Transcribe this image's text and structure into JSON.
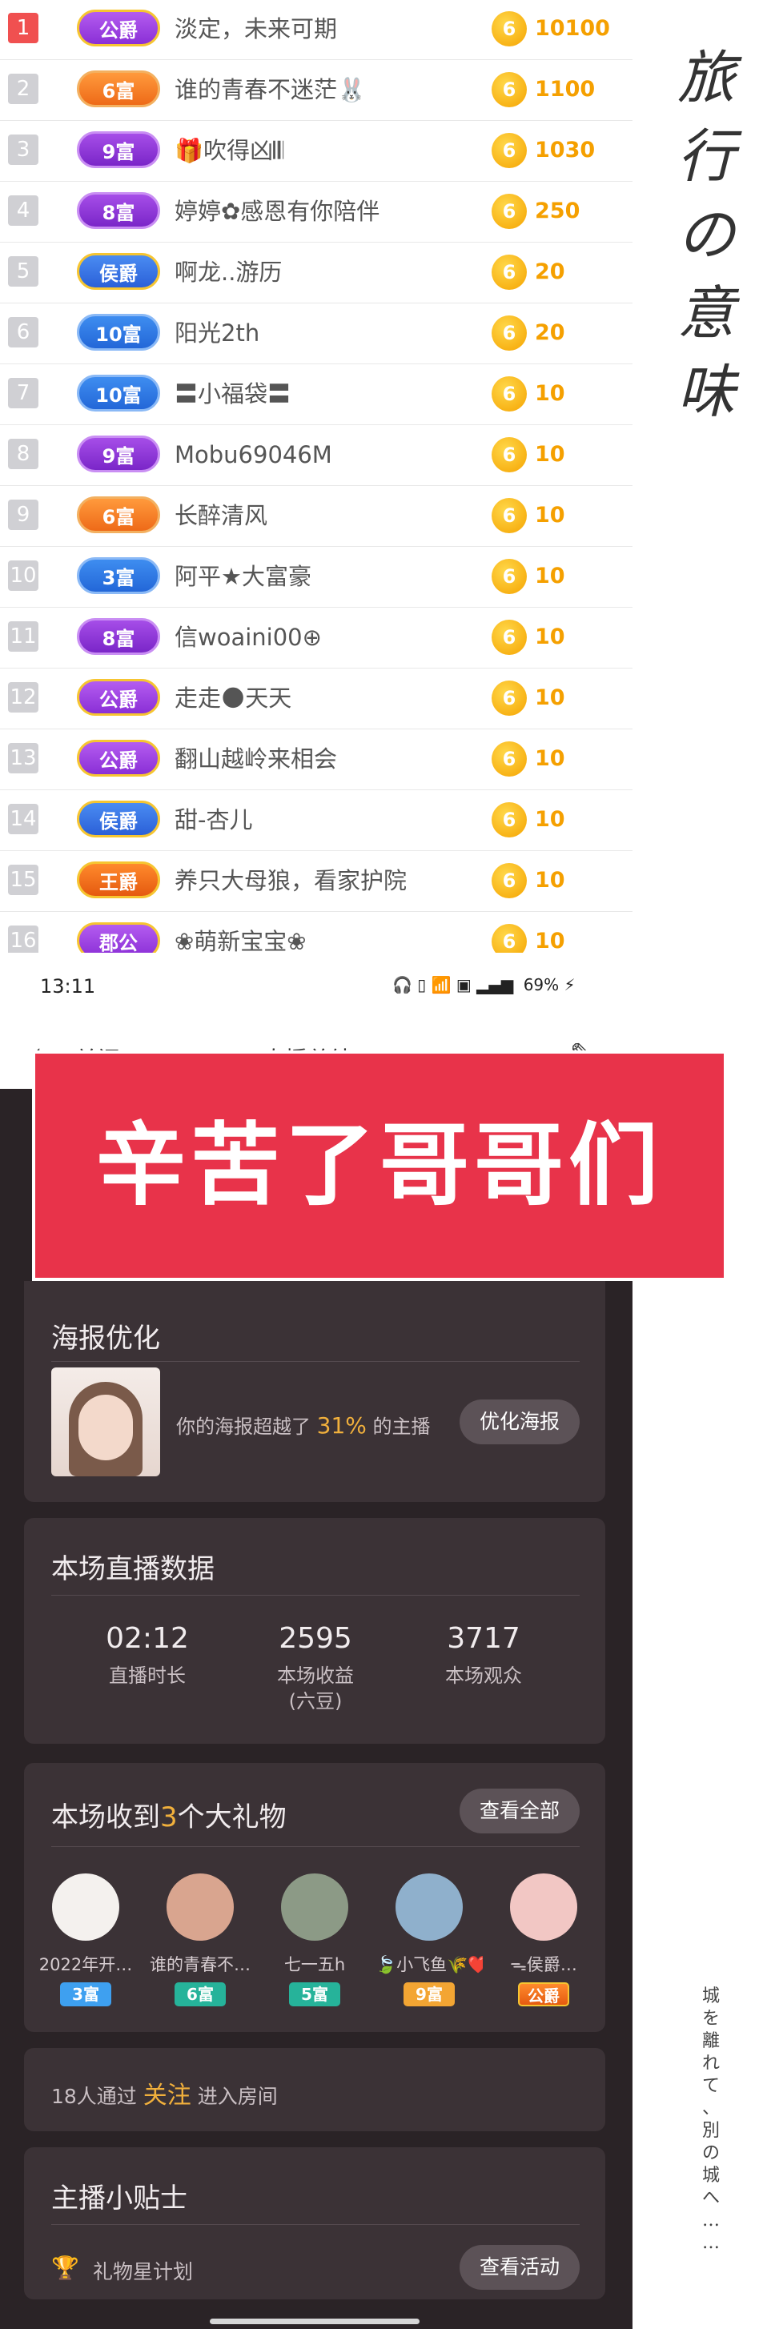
{
  "ranking": [
    {
      "rank": "1",
      "badge": "公爵",
      "badge_style": "b-gold-purple",
      "name": "淡定，未来可期",
      "value": "10100"
    },
    {
      "rank": "2",
      "badge": "6富",
      "badge_style": "b-orange",
      "name": "谁的青春不迷茫🐰",
      "value": "1100"
    },
    {
      "rank": "3",
      "badge": "9富",
      "badge_style": "b-purple",
      "name": "🎁吹得凶𝄃𝄃",
      "value": "1030"
    },
    {
      "rank": "4",
      "badge": "8富",
      "badge_style": "b-purple",
      "name": "婷婷✿感恩有你陪伴",
      "value": "250"
    },
    {
      "rank": "5",
      "badge": "侯爵",
      "badge_style": "b-gold-blue",
      "name": "啊龙..游历",
      "value": "20"
    },
    {
      "rank": "6",
      "badge": "10富",
      "badge_style": "b-blue",
      "name": "阳光2th",
      "value": "20"
    },
    {
      "rank": "7",
      "badge": "10富",
      "badge_style": "b-blue",
      "name": "〓小福袋〓",
      "value": "10"
    },
    {
      "rank": "8",
      "badge": "9富",
      "badge_style": "b-purple",
      "name": "Mobu69046M",
      "value": "10"
    },
    {
      "rank": "9",
      "badge": "6富",
      "badge_style": "b-orange",
      "name": "长醉清风",
      "value": "10"
    },
    {
      "rank": "10",
      "badge": "3富",
      "badge_style": "b-blue",
      "name": "阿平★大富豪",
      "value": "10"
    },
    {
      "rank": "11",
      "badge": "8富",
      "badge_style": "b-purple",
      "name": "信woaini00⊕",
      "value": "10"
    },
    {
      "rank": "12",
      "badge": "公爵",
      "badge_style": "b-gold-purple",
      "name": "走走🌑天天",
      "value": "10"
    },
    {
      "rank": "13",
      "badge": "公爵",
      "badge_style": "b-gold-purple",
      "name": "翻山越岭来相会",
      "value": "10"
    },
    {
      "rank": "14",
      "badge": "侯爵",
      "badge_style": "b-gold-blue",
      "name": "甜-杏儿",
      "value": "10"
    },
    {
      "rank": "15",
      "badge": "王爵",
      "badge_style": "b-gold-orange",
      "name": "养只大母狼，看家护院",
      "value": "10"
    },
    {
      "rank": "16",
      "badge": "郡公",
      "badge_style": "b-gold-purple",
      "name": "❀萌新宝宝❀",
      "value": "10"
    }
  ],
  "coin_glyph": "6",
  "side_title": [
    "旅",
    "行",
    "の",
    "意",
    "味"
  ],
  "side_poem": [
    "城",
    "を",
    "離",
    "れ",
    "て",
    "、",
    "別",
    "の",
    "城",
    "へ",
    "…",
    "…"
  ],
  "status": {
    "time": "13:11",
    "battery": "69%"
  },
  "nav": {
    "back_label": "关闭",
    "title": "直播总结"
  },
  "banner_text": "辛苦了哥哥们",
  "poster": {
    "title": "海报优化",
    "text_before": "你的海报超越了",
    "percent": "31%",
    "text_after": "的主播",
    "button": "优化海报"
  },
  "live": {
    "title": "本场直播数据",
    "stats": [
      {
        "value": "02:12",
        "label": "直播时长",
        "sub": ""
      },
      {
        "value": "2595",
        "label": "本场收益",
        "sub": "(六豆)"
      },
      {
        "value": "3717",
        "label": "本场观众",
        "sub": ""
      }
    ]
  },
  "gifts": {
    "title_before": "本场收到",
    "count": "3",
    "title_after": "个大礼物",
    "view_all": "查看全部",
    "senders": [
      {
        "name": "2022年开…",
        "badge": "3富",
        "badge_style": "gb-blue",
        "avatar_color": "#f4f1ee"
      },
      {
        "name": "谁的青春不…",
        "badge": "6富",
        "badge_style": "gb-teal",
        "avatar_color": "#d9a58f"
      },
      {
        "name": "七一五h",
        "badge": "5富",
        "badge_style": "gb-teal",
        "avatar_color": "#8c9a86"
      },
      {
        "name": "🍃小飞鱼🌾❤️",
        "badge": "9富",
        "badge_style": "gb-orange",
        "avatar_color": "#8fb0cc"
      },
      {
        "name": "ᯓ侯爵…",
        "badge": "公爵",
        "badge_style": "gb-gold",
        "avatar_color": "#f2c7c4"
      }
    ]
  },
  "follow": {
    "count_text": "18人通过",
    "highlight": "关注",
    "after": "进入房间"
  },
  "tips": {
    "title": "主播小贴士",
    "item": "礼物星计划",
    "button": "查看活动"
  }
}
